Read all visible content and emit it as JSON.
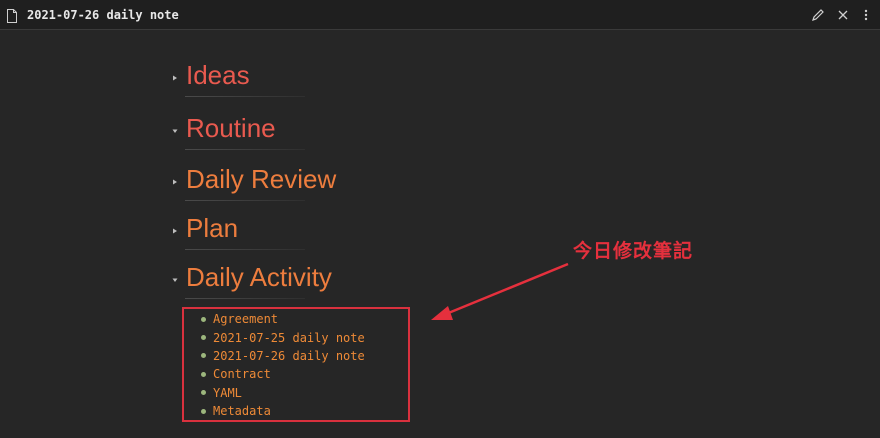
{
  "window": {
    "title": "2021-07-26 daily note",
    "icons": [
      "file-icon",
      "edit-icon",
      "close-icon",
      "more-icon"
    ]
  },
  "colors": {
    "background": "#262626",
    "heading_primary": "#e95a4f",
    "heading_secondary": "#ed7d3e",
    "list_text": "#ee8a37",
    "bullet": "#9cb67d",
    "annotation": "#e5303d"
  },
  "headings": [
    {
      "label": "Ideas",
      "collapsed": true
    },
    {
      "label": "Routine",
      "collapsed": false
    },
    {
      "label": "Daily Review",
      "collapsed": true
    },
    {
      "label": "Plan",
      "collapsed": true
    },
    {
      "label": "Daily Activity",
      "collapsed": false
    }
  ],
  "activity_list": [
    "Agreement",
    "2021-07-25 daily note",
    "2021-07-26 daily note",
    "Contract",
    "YAML",
    "Metadata"
  ],
  "annotation": {
    "text": "今日修改筆記"
  }
}
